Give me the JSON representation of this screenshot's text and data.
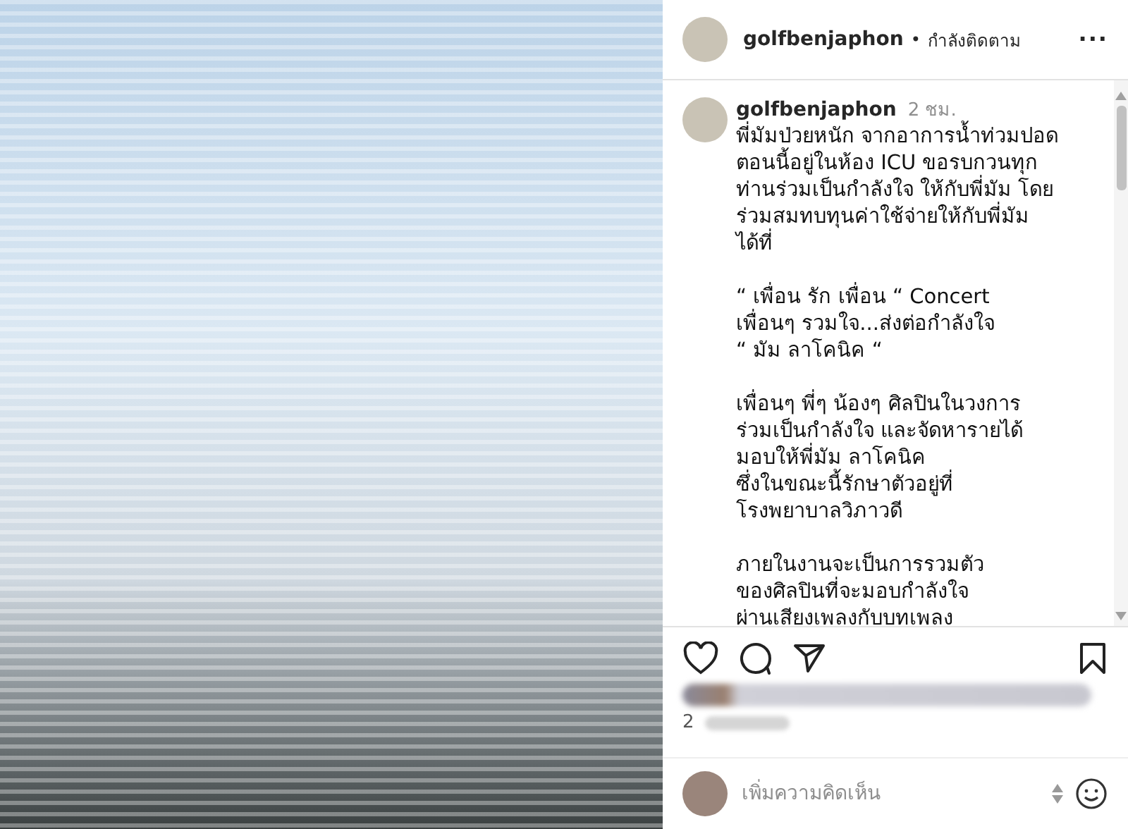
{
  "header": {
    "username": "golfbenjaphon",
    "separator": "•",
    "follow_status": "กำลังติดตาม",
    "more": "..."
  },
  "caption": {
    "username": "golfbenjaphon",
    "time": "2 ชม.",
    "paragraphs": [
      [
        "พี่มัมป่วยหนัก จากอาการน้ำท่วมปอด",
        "ตอนนี้อยู่ในห้อง ICU ขอรบกวนทุก",
        "ท่านร่วมเป็นกำลังใจ ให้กับพี่มัม โดย",
        "ร่วมสมทบทุนค่าใช้จ่ายให้กับพี่มัม",
        "ได้ที่"
      ],
      [
        "“ เพื่อน รัก เพื่อน “ Concert",
        "เพื่อนๆ รวมใจ...ส่งต่อกำลังใจ",
        "“ มัม ลาโคนิค “"
      ],
      [
        "เพื่อนๆ พี่ๆ น้องๆ ศิลปินในวงการ",
        "ร่วมเป็นกำลังใจ และจัดหารายได้",
        "มอบให้พี่มัม ลาโคนิค",
        "ซึ่งในขณะนี้รักษาตัวอยู่ที่",
        "โรงพยาบาลวิภาวดี"
      ],
      [
        "ภายในงานจะเป็นการรวมตัว",
        "ของศิลปินที่จะมอบกำลังใจ",
        "ผ่านเสียงเพลงกับบทเพลง"
      ]
    ]
  },
  "likes": {
    "count_prefix": "2"
  },
  "comment": {
    "placeholder": "เพิ่มความคิดเห็น"
  }
}
